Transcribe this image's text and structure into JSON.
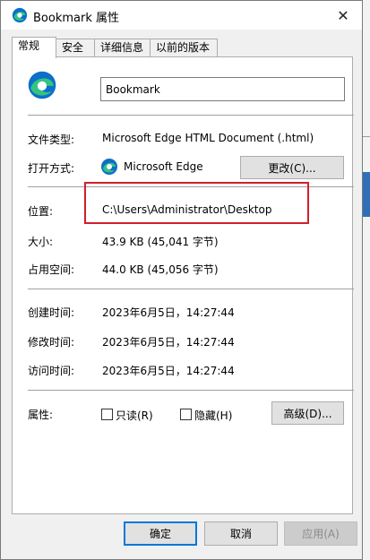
{
  "window": {
    "title": "Bookmark 属性",
    "close_glyph": "✕"
  },
  "tabs": [
    {
      "label": "常规",
      "active": true
    },
    {
      "label": "安全"
    },
    {
      "label": "详细信息"
    },
    {
      "label": "以前的版本"
    }
  ],
  "general": {
    "name_value": "Bookmark",
    "file_type_label": "文件类型:",
    "file_type_value": "Microsoft Edge HTML Document (.html)",
    "open_with_label": "打开方式:",
    "open_with_value": "Microsoft Edge",
    "change_button": "更改(C)...",
    "location_label": "位置:",
    "location_value": "C:\\Users\\Administrator\\Desktop",
    "size_label": "大小:",
    "size_value": "43.9 KB (45,041 字节)",
    "disk_size_label": "占用空间:",
    "disk_size_value": "44.0 KB (45,056 字节)",
    "created_label": "创建时间:",
    "created_value": "2023年6月5日，14:27:44",
    "modified_label": "修改时间:",
    "modified_value": "2023年6月5日，14:27:44",
    "accessed_label": "访问时间:",
    "accessed_value": "2023年6月5日，14:27:44",
    "attributes_label": "属性:",
    "readonly_label": "只读(R)",
    "hidden_label": "隐藏(H)",
    "advanced_button": "高级(D)..."
  },
  "footer": {
    "ok": "确定",
    "cancel": "取消",
    "apply": "应用(A)"
  },
  "colors": {
    "edge_blue": "#0c6fc9",
    "edge_green": "#33c481",
    "highlight_red": "#d0202a",
    "accent": "#0078d7"
  }
}
